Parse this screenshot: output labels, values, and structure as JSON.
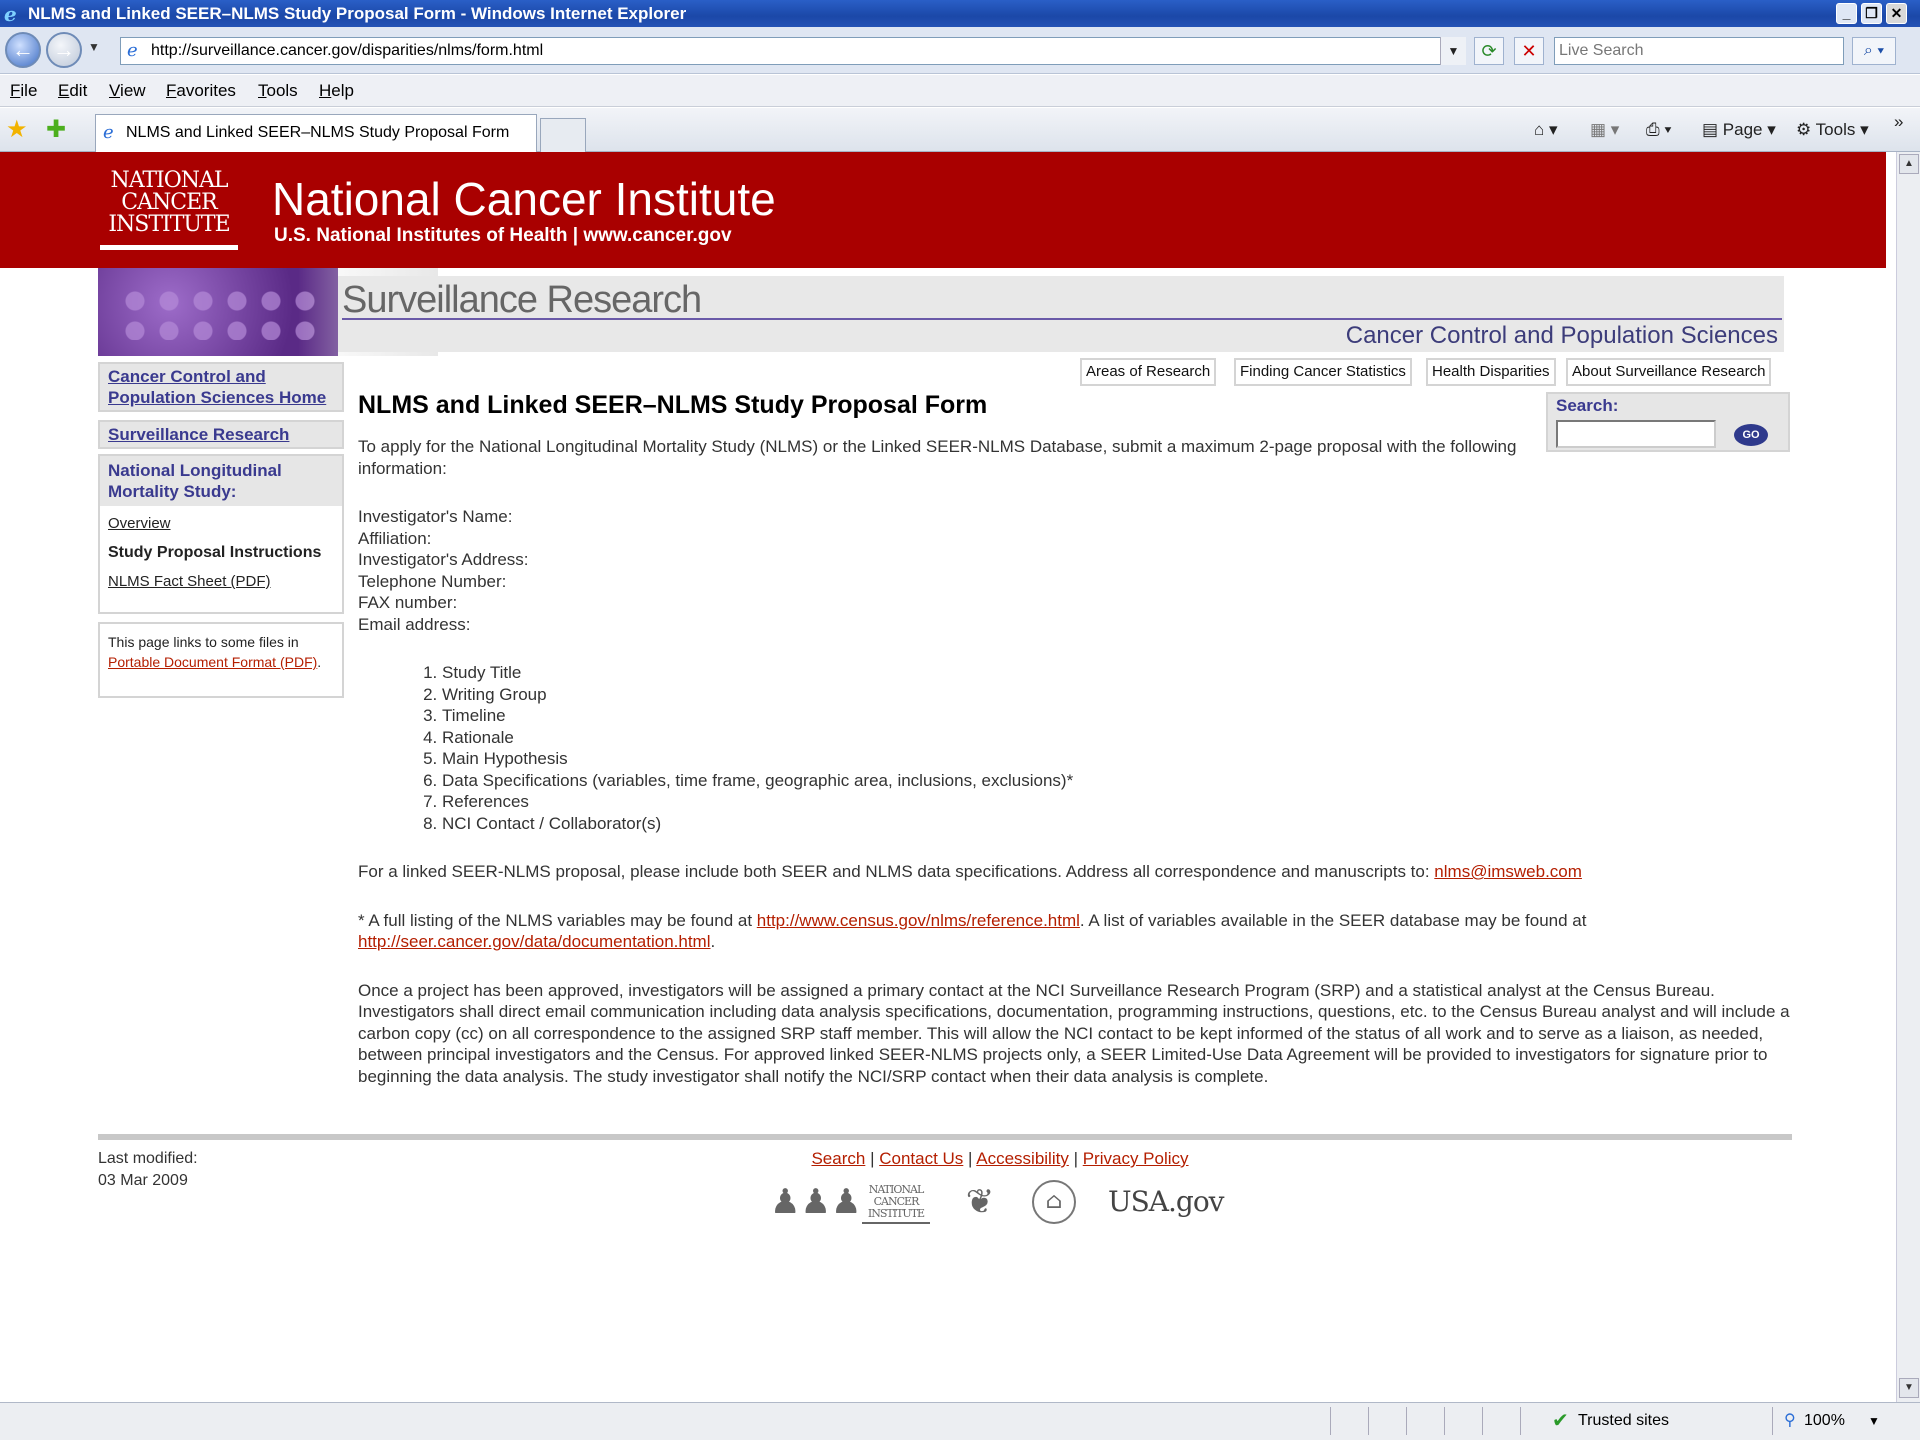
{
  "window": {
    "title": "NLMS and Linked SEER–NLMS Study Proposal Form - Windows Internet Explorer"
  },
  "addressbar": {
    "url": "http://surveillance.cancer.gov/disparities/nlms/form.html",
    "search_placeholder": "Live Search"
  },
  "menubar": [
    "File",
    "Edit",
    "View",
    "Favorites",
    "Tools",
    "Help"
  ],
  "tabs": [
    {
      "label": "NLMS and Linked SEER–NLMS Study Proposal Form"
    }
  ],
  "toolbar": {
    "page_label": "Page",
    "tools_label": "Tools"
  },
  "header": {
    "logo_lines": [
      "NATIONAL",
      "CANCER",
      "INSTITUTE"
    ],
    "title": "National Cancer Institute",
    "subtitle": "U.S. National Institutes of Health  |  www.cancer.gov",
    "section_title": "Surveillance Research",
    "section_subtitle": "Cancer Control and Population Sciences"
  },
  "topnav": [
    "Areas of Research",
    "Finding Cancer Statistics",
    "Health Disparities",
    "About Surveillance Research"
  ],
  "sidebar": {
    "home_link": "Cancer Control and Population Sciences Home",
    "sr_link": "Surveillance Research",
    "nlms_heading": "National Longitudinal Mortality Study:",
    "nlms_items": [
      "Overview",
      "Study Proposal Instructions",
      "NLMS Fact Sheet (PDF)"
    ],
    "pdf_note_prefix": "This page links to some files in ",
    "pdf_note_link": "Portable Document Format (PDF)",
    "pdf_note_suffix": "."
  },
  "search": {
    "label": "Search:",
    "go": "GO"
  },
  "content": {
    "title": "NLMS and Linked SEER–NLMS Study Proposal Form",
    "intro": "To apply for the National Longitudinal Mortality Study (NLMS) or the Linked SEER-NLMS Database, submit a maximum 2-page proposal with the following information:",
    "fields": [
      "Investigator's Name:",
      "Affiliation:",
      "Investigator's Address:",
      "Telephone Number:",
      "FAX number:",
      "Email address:"
    ],
    "items": [
      "Study Title",
      "Writing Group",
      "Timeline",
      "Rationale",
      "Main Hypothesis",
      "Data Specifications (variables, time frame, geographic area, inclusions, exclusions)*",
      "References",
      "NCI Contact / Collaborator(s)"
    ],
    "linked_text": "For a linked SEER-NLMS proposal, please include both SEER and NLMS data specifications. Address all correspondence and manuscripts to: ",
    "linked_email": "nlms@imsweb.com",
    "note_prefix": "* A full listing of the NLMS variables may be found at ",
    "note_link1": "http://www.census.gov/nlms/reference.html",
    "note_middle": ". A list of variables available in the SEER database may be found at ",
    "note_link2": "http://seer.cancer.gov/data/documentation.html",
    "note_suffix": ".",
    "approval": "Once a project has been approved, investigators will be assigned a primary contact at the NCI Surveillance Research Program (SRP) and a statistical analyst at the Census Bureau. Investigators shall direct email communication including data analysis specifications, documentation, programming instructions, questions, etc. to the Census Bureau analyst and will include a carbon copy (cc) on all correspondence to the assigned SRP staff member. This will allow the NCI contact to be kept informed of the status of all work and to serve as a liaison, as needed, between principal investigators and the Census. For approved linked SEER-NLMS projects only, a SEER Limited-Use Data Agreement will be provided to investigators for signature prior to beginning the data analysis. The study investigator shall notify the NCI/SRP contact when their data analysis is complete."
  },
  "footer": {
    "last_modified_label": "Last modified:",
    "last_modified_date": "03 Mar 2009",
    "links": [
      "Search",
      "Contact Us",
      "Accessibility",
      "Privacy Policy"
    ],
    "logo_usa": "USA.gov"
  },
  "statusbar": {
    "zone": "Trusted sites",
    "zoom": "100%"
  },
  "colors": {
    "nci_red": "#a90000",
    "link_red": "#b41e00",
    "nav_blue": "#3a3a8f"
  }
}
